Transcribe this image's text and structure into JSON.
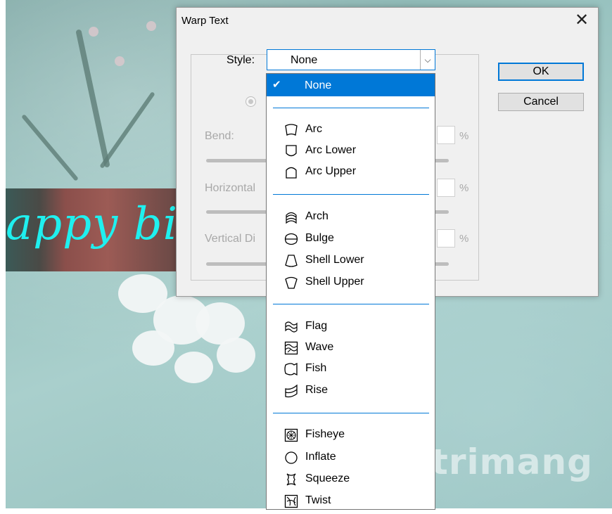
{
  "background": {
    "banner_text": "appy birt",
    "watermark": "uantrimang"
  },
  "dialog": {
    "title": "Warp Text",
    "close_glyph": "✕",
    "style_label": "Style:",
    "style_value": "None",
    "dropdown_arrow": "⌵",
    "bend_label": "Bend:",
    "horizontal_label": "Horizontal",
    "vertical_label": "Vertical Di",
    "percent": "%",
    "ok_label": "OK",
    "cancel_label": "Cancel"
  },
  "dropdown": {
    "selected": {
      "check": "✔",
      "label": "None"
    },
    "groups": [
      [
        {
          "label": "Arc",
          "icon": "arc-icon"
        },
        {
          "label": "Arc Lower",
          "icon": "arc-lower-icon"
        },
        {
          "label": "Arc Upper",
          "icon": "arc-upper-icon"
        }
      ],
      [
        {
          "label": "Arch",
          "icon": "arch-icon"
        },
        {
          "label": "Bulge",
          "icon": "bulge-icon"
        },
        {
          "label": "Shell Lower",
          "icon": "shell-lower-icon"
        },
        {
          "label": "Shell Upper",
          "icon": "shell-upper-icon"
        }
      ],
      [
        {
          "label": "Flag",
          "icon": "flag-icon"
        },
        {
          "label": "Wave",
          "icon": "wave-icon"
        },
        {
          "label": "Fish",
          "icon": "fish-icon"
        },
        {
          "label": "Rise",
          "icon": "rise-icon"
        }
      ],
      [
        {
          "label": "Fisheye",
          "icon": "fisheye-icon"
        },
        {
          "label": "Inflate",
          "icon": "inflate-icon"
        },
        {
          "label": "Squeeze",
          "icon": "squeeze-icon"
        },
        {
          "label": "Twist",
          "icon": "twist-icon"
        }
      ]
    ]
  },
  "colors": {
    "accent": "#0078d7",
    "banner_text": "#1ff0ef"
  }
}
